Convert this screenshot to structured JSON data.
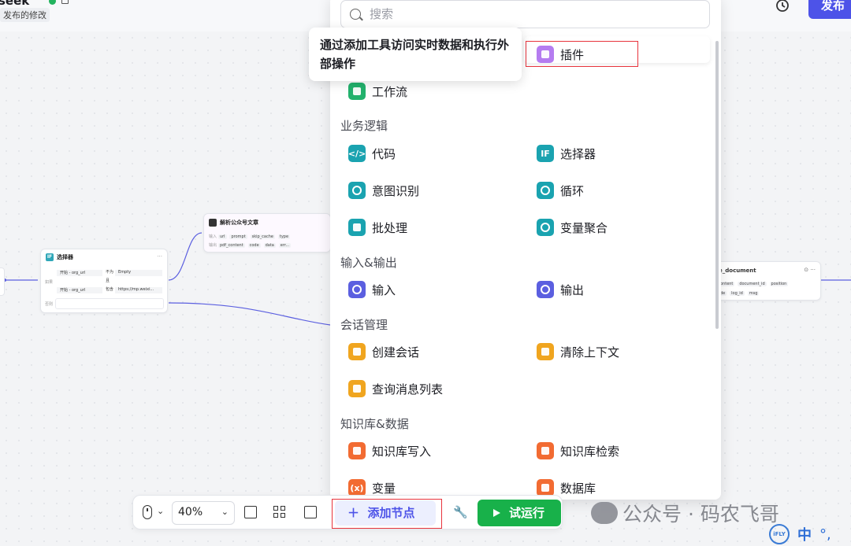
{
  "topbar": {
    "app_title": "seek",
    "unpublished_label": "发布的修改",
    "publish_label": "发布"
  },
  "canvas": {
    "selector_node": {
      "title": "选择器",
      "if_label": "如果",
      "else_label": "否则",
      "conditions": [
        {
          "left": "开始 - org_url",
          "op": "不为",
          "right": "Empty"
        },
        {
          "connector": "且"
        },
        {
          "left": "开始 - org_url",
          "op": "包含",
          "right": "https://mp.weixi..."
        }
      ]
    },
    "parse_node": {
      "title": "解析公众号文章",
      "input_label": "输入",
      "output_label": "输出",
      "inputs": [
        "url",
        "prompt",
        "skip_cache",
        "type"
      ],
      "outputs": [
        "pdf_content",
        "code",
        "data",
        "err..."
      ]
    },
    "doc_node": {
      "title": "e_document",
      "row1": [
        "ontent",
        "document_id",
        "position"
      ],
      "row2": [
        "de",
        "log_id",
        "msg"
      ]
    }
  },
  "panel": {
    "search_placeholder": "搜索",
    "tooltip": "通过添加工具访问实时数据和执行外部操作",
    "plugin_label": "插件",
    "workflow_label": "工作流",
    "sections": {
      "logic": "业务逻辑",
      "io": "输入&输出",
      "conversation": "会话管理",
      "knowledge": "知识库&数据"
    },
    "items": {
      "code": "代码",
      "selector": "选择器",
      "intent": "意图识别",
      "loop": "循环",
      "batch": "批处理",
      "aggregate": "变量聚合",
      "input": "输入",
      "output": "输出",
      "create_conv": "创建会话",
      "clear_ctx": "清除上下文",
      "msg_list": "查询消息列表",
      "kb_write": "知识库写入",
      "kb_search": "知识库检索",
      "variable": "变量",
      "database": "数据库"
    }
  },
  "toolbar": {
    "zoom": "40%",
    "add_node": "添加节点",
    "run": "试运行"
  },
  "watermark": "公众号 · 码农飞哥",
  "ime": {
    "badge": "iFLY",
    "lang": "中"
  },
  "colors": {
    "accent": "#4d53e8",
    "run_green": "#18b14a",
    "highlight_red": "#e8333c"
  }
}
